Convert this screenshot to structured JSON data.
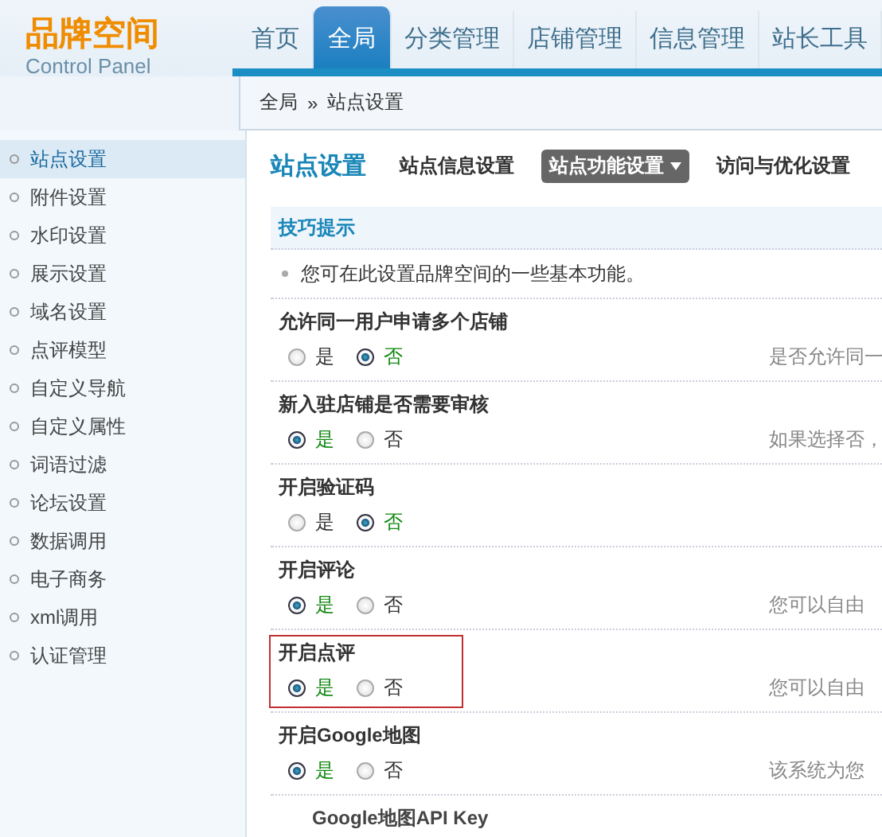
{
  "logo": {
    "title": "品牌空间",
    "subtitle": "Control Panel"
  },
  "nav_tabs": [
    {
      "label": "首页",
      "selected": false
    },
    {
      "label": "全局",
      "selected": true
    },
    {
      "label": "分类管理",
      "selected": false
    },
    {
      "label": "店铺管理",
      "selected": false
    },
    {
      "label": "信息管理",
      "selected": false
    },
    {
      "label": "站长工具",
      "selected": false
    }
  ],
  "breadcrumb": {
    "items": [
      "全局",
      "站点设置"
    ],
    "separator": "»"
  },
  "sidebar": {
    "items": [
      {
        "label": "站点设置",
        "selected": true
      },
      {
        "label": "附件设置",
        "selected": false
      },
      {
        "label": "水印设置",
        "selected": false
      },
      {
        "label": "展示设置",
        "selected": false
      },
      {
        "label": "域名设置",
        "selected": false
      },
      {
        "label": "点评模型",
        "selected": false
      },
      {
        "label": "自定义导航",
        "selected": false
      },
      {
        "label": "自定义属性",
        "selected": false
      },
      {
        "label": "词语过滤",
        "selected": false
      },
      {
        "label": "论坛设置",
        "selected": false
      },
      {
        "label": "数据调用",
        "selected": false
      },
      {
        "label": "电子商务",
        "selected": false
      },
      {
        "label": "xml调用",
        "selected": false
      },
      {
        "label": "认证管理",
        "selected": false
      }
    ]
  },
  "page": {
    "title": "站点设置",
    "subtabs": [
      {
        "label": "站点信息设置",
        "selected": false,
        "dropdown": false
      },
      {
        "label": "站点功能设置",
        "selected": true,
        "dropdown": true
      },
      {
        "label": "访问与优化设置",
        "selected": false,
        "dropdown": false
      }
    ]
  },
  "tips": {
    "title": "技巧提示",
    "items": [
      "您可在此设置品牌空间的一些基本功能。"
    ]
  },
  "settings": [
    {
      "label": "允许同一用户申请多个店铺",
      "options": [
        {
          "label": "是",
          "selected": false
        },
        {
          "label": "否",
          "selected": true
        }
      ],
      "description": "是否允许同一",
      "highlighted": false
    },
    {
      "label": "新入驻店铺是否需要审核",
      "options": [
        {
          "label": "是",
          "selected": true
        },
        {
          "label": "否",
          "selected": false
        }
      ],
      "description": "如果选择否，",
      "highlighted": false
    },
    {
      "label": "开启验证码",
      "options": [
        {
          "label": "是",
          "selected": false
        },
        {
          "label": "否",
          "selected": true
        }
      ],
      "highlighted": false
    },
    {
      "label": "开启评论",
      "options": [
        {
          "label": "是",
          "selected": true
        },
        {
          "label": "否",
          "selected": false
        }
      ],
      "description": "您可以自由",
      "highlighted": false
    },
    {
      "label": "开启点评",
      "options": [
        {
          "label": "是",
          "selected": true
        },
        {
          "label": "否",
          "selected": false
        }
      ],
      "description": "您可以自由",
      "highlighted": true
    },
    {
      "label": "开启Google地图",
      "options": [
        {
          "label": "是",
          "selected": true
        },
        {
          "label": "否",
          "selected": false
        }
      ],
      "description": "该系统为您",
      "highlighted": false
    }
  ],
  "sub_setting": {
    "label": "Google地图API Key"
  }
}
